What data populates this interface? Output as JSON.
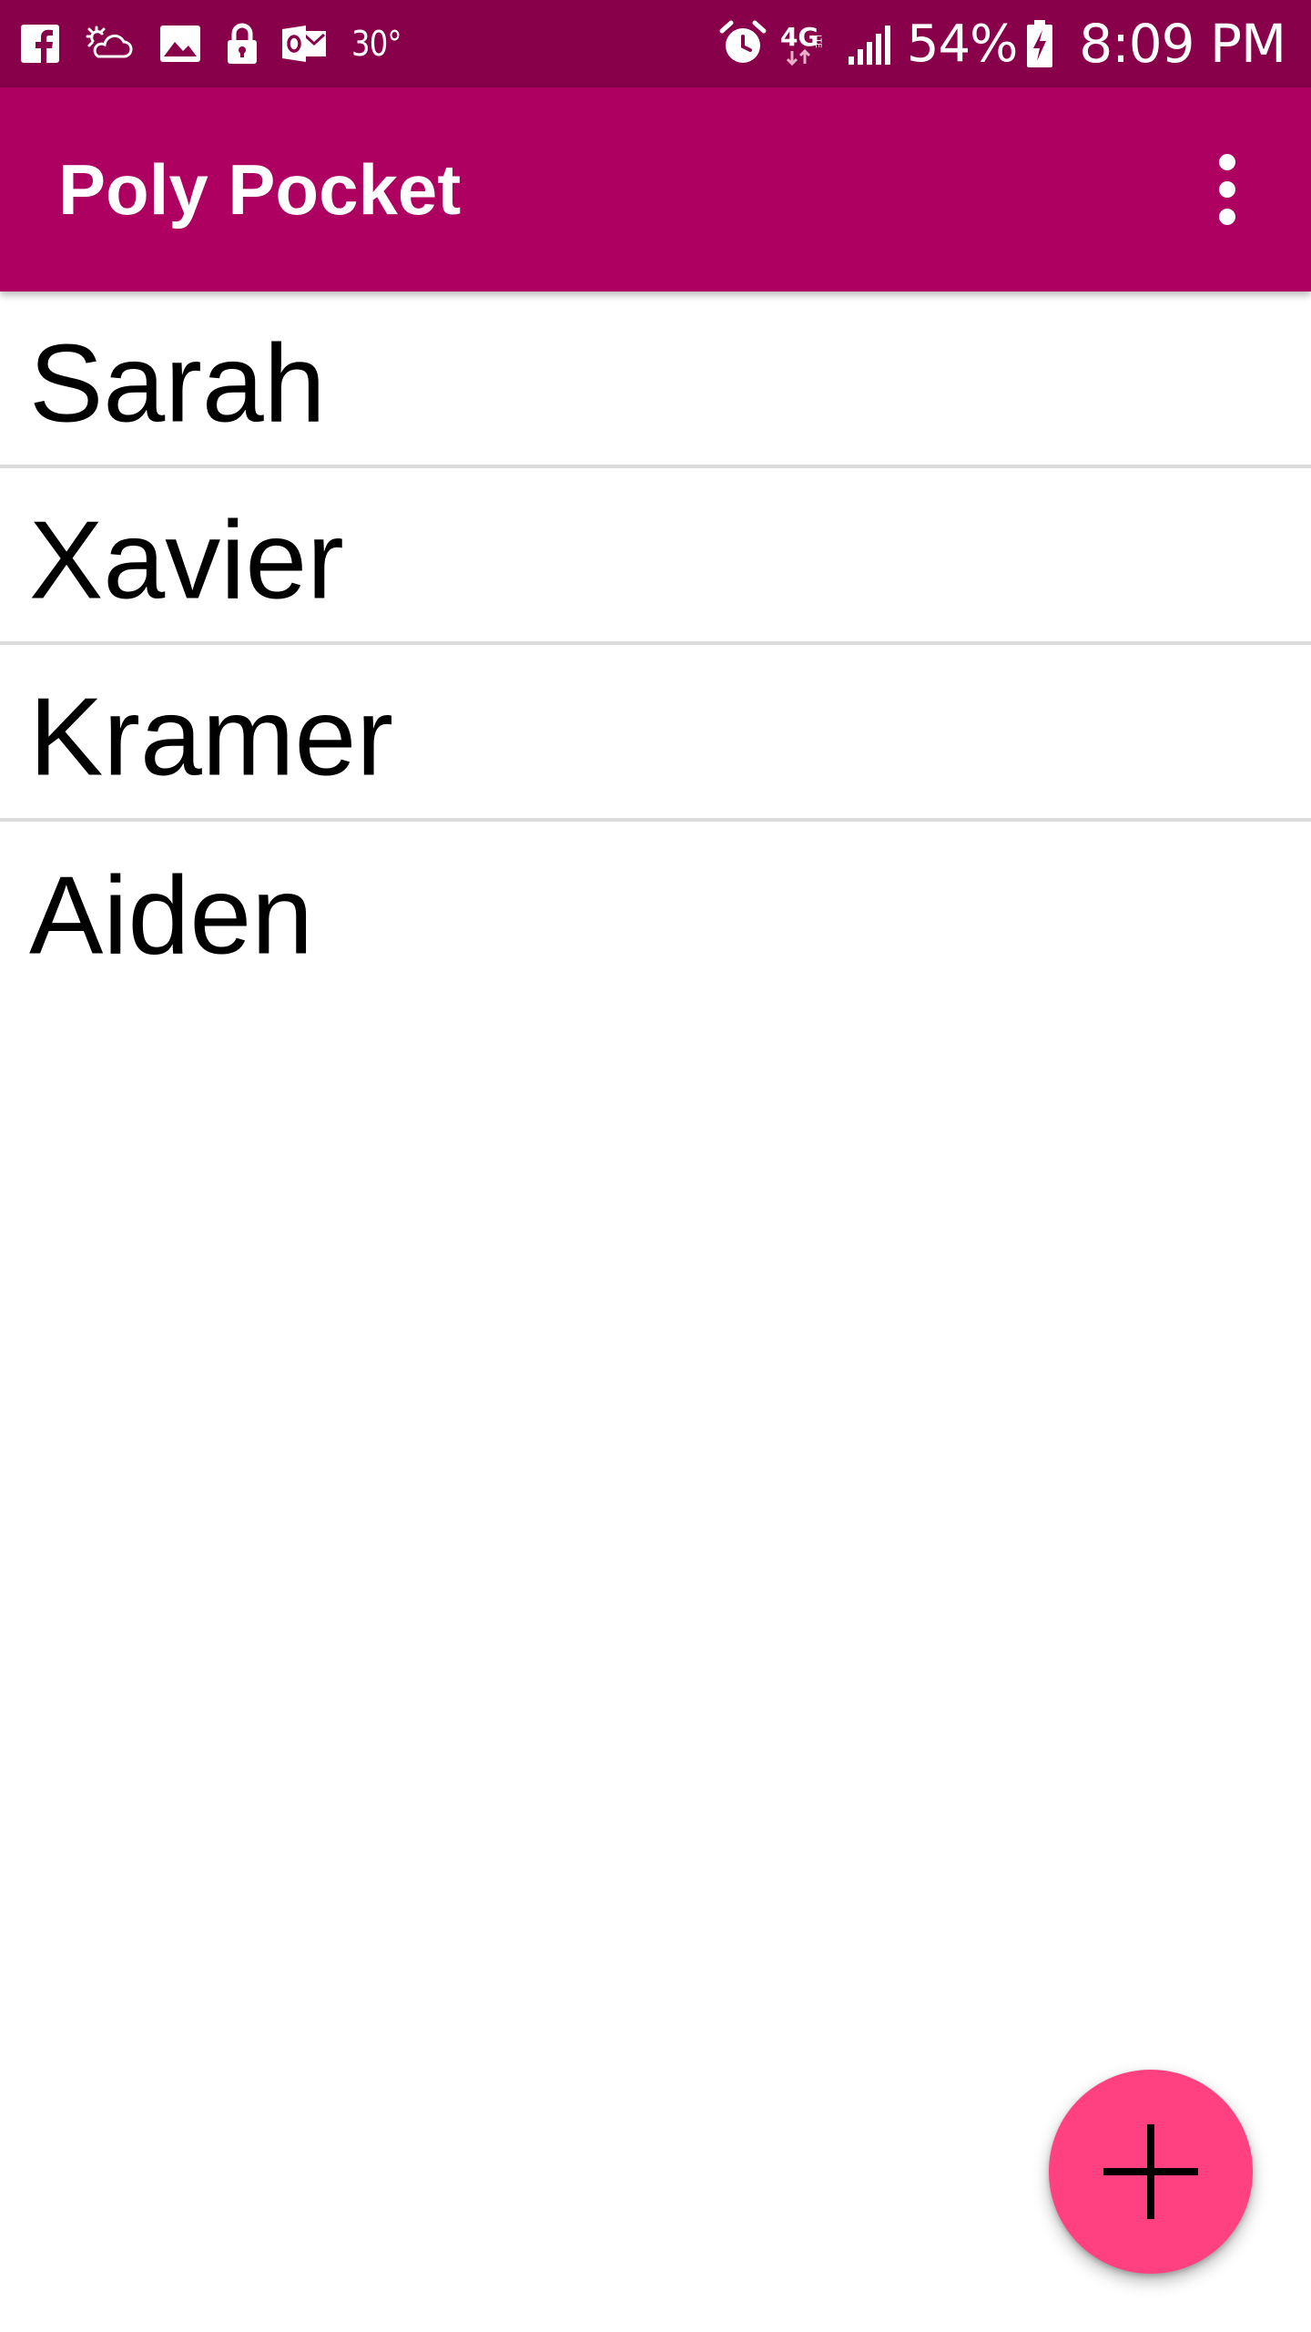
{
  "colors": {
    "status_bar": "#880049",
    "app_bar": "#ad0060",
    "fab": "#ff4081",
    "divider": "#dcdcdc",
    "text": "#000000"
  },
  "status_bar": {
    "left_icons": [
      "facebook-icon",
      "partly-cloudy-icon",
      "gallery-icon",
      "lock-icon",
      "outlook-icon"
    ],
    "temperature": "30°",
    "right_icons": [
      "alarm-icon",
      "4g-lte-icon",
      "signal-icon"
    ],
    "battery_percent": "54%",
    "battery_icon": "battery-charging-icon",
    "time": "8:09 PM"
  },
  "app_bar": {
    "title": "Poly Pocket",
    "menu_icon": "more-vert-icon"
  },
  "list": {
    "items": [
      {
        "label": "Sarah"
      },
      {
        "label": "Xavier"
      },
      {
        "label": "Kramer"
      },
      {
        "label": "Aiden"
      }
    ]
  },
  "fab": {
    "icon": "plus-icon"
  }
}
